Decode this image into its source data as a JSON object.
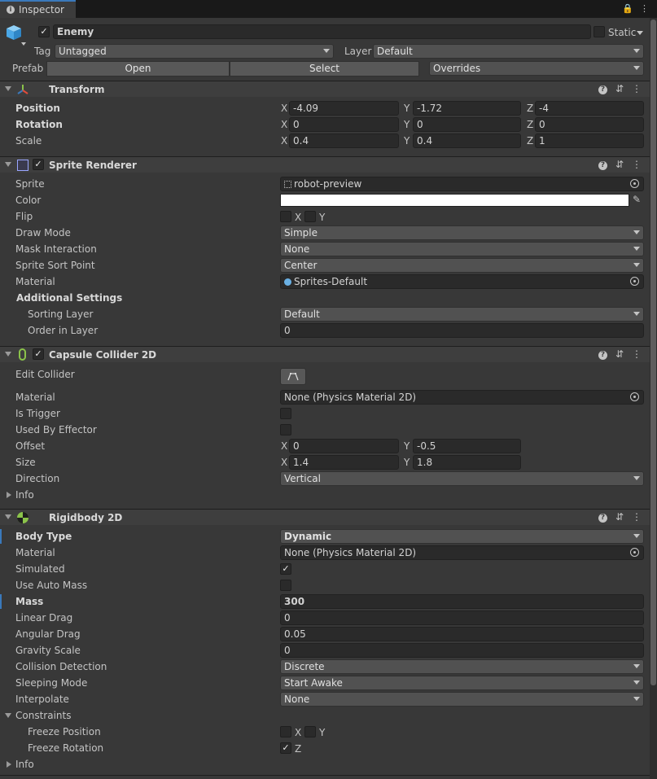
{
  "tab": {
    "title": "Inspector"
  },
  "object": {
    "name": "Enemy",
    "static_label": "Static",
    "tag_label": "Tag",
    "tag_value": "Untagged",
    "layer_label": "Layer",
    "layer_value": "Default",
    "prefab_label": "Prefab",
    "open": "Open",
    "select": "Select",
    "overrides": "Overrides"
  },
  "transform": {
    "title": "Transform",
    "position_label": "Position",
    "rotation_label": "Rotation",
    "scale_label": "Scale",
    "position": {
      "x": "-4.09",
      "y": "-1.72",
      "z": "-4"
    },
    "rotation": {
      "x": "0",
      "y": "0",
      "z": "0"
    },
    "scale": {
      "x": "0.4",
      "y": "0.4",
      "z": "1"
    },
    "axes": {
      "x": "X",
      "y": "Y",
      "z": "Z"
    }
  },
  "sprite_renderer": {
    "title": "Sprite Renderer",
    "sprite_label": "Sprite",
    "sprite": "robot-preview",
    "color_label": "Color",
    "color": "#ffffff",
    "flip_label": "Flip",
    "flip_x": "X",
    "flip_y": "Y",
    "draw_mode_label": "Draw Mode",
    "draw_mode": "Simple",
    "mask_label": "Mask Interaction",
    "mask": "None",
    "sort_point_label": "Sprite Sort Point",
    "sort_point": "Center",
    "material_label": "Material",
    "material": "Sprites-Default",
    "additional_label": "Additional Settings",
    "sorting_layer_label": "Sorting Layer",
    "sorting_layer": "Default",
    "order_label": "Order in Layer",
    "order": "0"
  },
  "capsule": {
    "title": "Capsule Collider 2D",
    "edit_label": "Edit Collider",
    "material_label": "Material",
    "material": "None (Physics Material 2D)",
    "trigger_label": "Is Trigger",
    "effector_label": "Used By Effector",
    "offset_label": "Offset",
    "offset": {
      "x": "0",
      "y": "-0.5"
    },
    "size_label": "Size",
    "size": {
      "x": "1.4",
      "y": "1.8"
    },
    "direction_label": "Direction",
    "direction": "Vertical",
    "info_label": "Info"
  },
  "rigidbody": {
    "title": "Rigidbody 2D",
    "body_type_label": "Body Type",
    "body_type": "Dynamic",
    "material_label": "Material",
    "material": "None (Physics Material 2D)",
    "simulated_label": "Simulated",
    "auto_mass_label": "Use Auto Mass",
    "mass_label": "Mass",
    "mass": "300",
    "linear_drag_label": "Linear Drag",
    "linear_drag": "0",
    "angular_drag_label": "Angular Drag",
    "angular_drag": "0.05",
    "gravity_label": "Gravity Scale",
    "gravity": "0",
    "collision_label": "Collision Detection",
    "collision": "Discrete",
    "sleeping_label": "Sleeping Mode",
    "sleeping": "Start Awake",
    "interpolate_label": "Interpolate",
    "interpolate": "None",
    "constraints_label": "Constraints",
    "freeze_pos_label": "Freeze Position",
    "freeze_rot_label": "Freeze Rotation",
    "fx": "X",
    "fy": "Y",
    "fz": "Z",
    "info_label": "Info"
  },
  "colors": {
    "accent": "#3a79bb"
  }
}
